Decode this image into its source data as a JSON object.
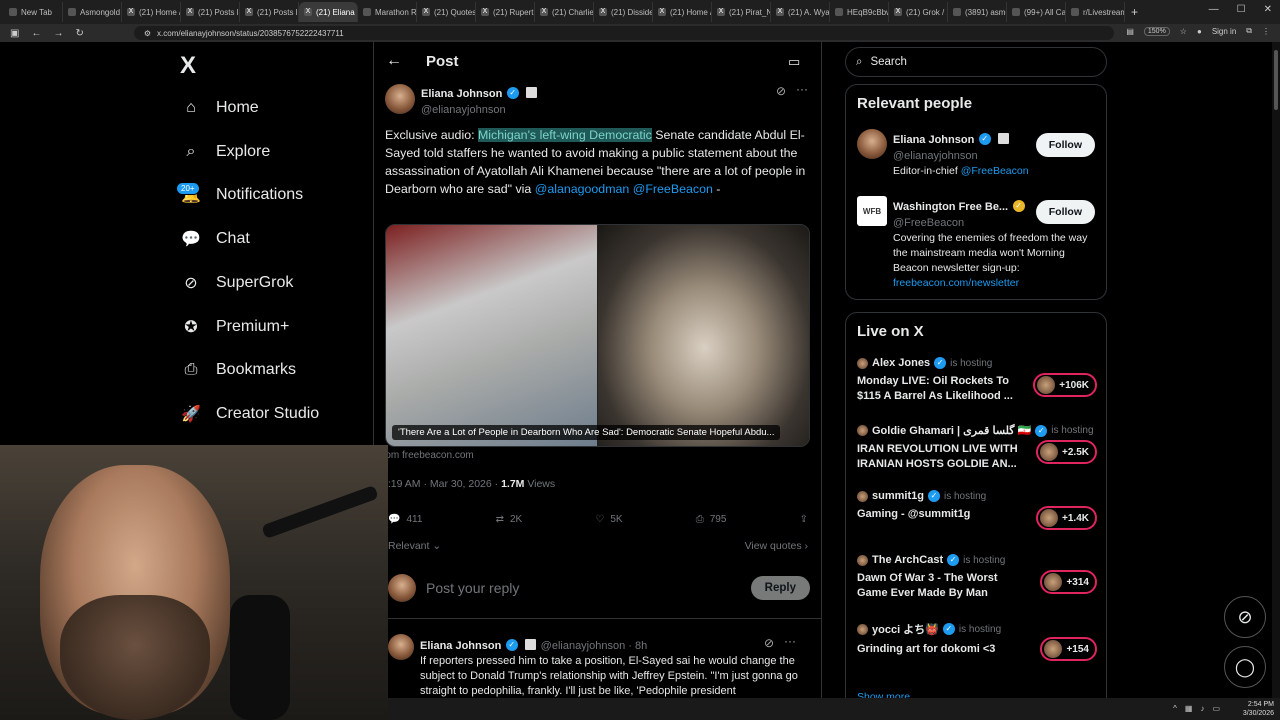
{
  "browser": {
    "tabs": [
      {
        "label": "New Tab",
        "fav": ""
      },
      {
        "label": "Asmongold",
        "fav": ""
      },
      {
        "label": "(21) Home / X",
        "fav": "X"
      },
      {
        "label": "(21) Posts like",
        "fav": "X"
      },
      {
        "label": "(21) Posts like",
        "fav": "X"
      },
      {
        "label": "(21) Eliana",
        "fav": "X"
      },
      {
        "label": "Marathon Rev",
        "fav": ""
      },
      {
        "label": "(21) Quotes of",
        "fav": "X"
      },
      {
        "label": "(21) Rupert Lo",
        "fav": "X"
      },
      {
        "label": "(21) Charlie D",
        "fav": "X"
      },
      {
        "label": "(21) Dissident",
        "fav": "X"
      },
      {
        "label": "(21) Home / X",
        "fav": "X"
      },
      {
        "label": "(21) Pirat_Nat",
        "fav": "X"
      },
      {
        "label": "(21) A. Wyatt",
        "fav": "X"
      },
      {
        "label": "HEqB9cBbwA",
        "fav": ""
      },
      {
        "label": "(21) Grok / X",
        "fav": "X"
      },
      {
        "label": "(3891) asmon",
        "fav": ""
      },
      {
        "label": "(99+) All Cate",
        "fav": ""
      },
      {
        "label": "r/Livestreamf",
        "fav": ""
      }
    ],
    "active_tab_index": 5,
    "url": "x.com/elianayjohnson/status/2038576752222437711",
    "zoom": "150%",
    "signin": "Sign in"
  },
  "sidebar": {
    "logo": "X",
    "items": [
      {
        "label": "Home",
        "icon": "home-icon"
      },
      {
        "label": "Explore",
        "icon": "search-icon"
      },
      {
        "label": "Notifications",
        "icon": "bell-icon"
      },
      {
        "label": "Chat",
        "icon": "chat-icon"
      },
      {
        "label": "SuperGrok",
        "icon": "grok-icon"
      },
      {
        "label": "Premium+",
        "icon": "premium-icon"
      },
      {
        "label": "Bookmarks",
        "icon": "bookmark-icon"
      },
      {
        "label": "Creator Studio",
        "icon": "rocket-icon"
      }
    ],
    "notifications_badge": "20+"
  },
  "post": {
    "header_title": "Post",
    "author_name": "Eliana Johnson",
    "author_handle": "@elianayjohnson",
    "text_highlight": "Michigan's left-wing Democratic",
    "text_prefix": "Exclusive audio: ",
    "text_rest": " Senate candidate Abdul El-Sayed told staffers he wanted to avoid making a public statement about the assassination of Ayatollah Ali Khamenei because \"there are a lot of people in Dearborn who are sad\" via ",
    "mention1": "@alanagoodman",
    "mention2": "@FreeBeacon",
    "text_end": " -",
    "media_caption": "'There Are a Lot of People in Dearborn Who Are Sad': Democratic Senate Hopeful Abdu...",
    "from_source": "rom freebeacon.com",
    "timestamp": "6:19 AM · Mar 30, 2026 · ",
    "views_count": "1.7M",
    "views_label": " Views",
    "replies": "411",
    "reposts": "2K",
    "likes": "5K",
    "bookmarks": "795",
    "sort_label": "Relevant",
    "view_quotes": "View quotes",
    "reply_placeholder": "Post your reply",
    "reply_button": "Reply"
  },
  "reply": {
    "author_name": "Eliana Johnson",
    "author_handle": "@elianayjohnson · 8h",
    "text": "If reporters pressed him to take a position, El-Sayed sai he would change the subject to Donald Trump's relationship with Jeffrey Epstein. \"I'm just gonna go straight to pedophilia, frankly. I'll just be like, 'Pedophile president"
  },
  "right": {
    "search_placeholder": "Search",
    "relevant_title": "Relevant people",
    "people": [
      {
        "name": "Eliana Johnson",
        "handle": "@elianayjohnson",
        "bio_prefix": "Editor-in-chief ",
        "bio_link": "@FreeBeacon",
        "follow": "Follow"
      },
      {
        "name": "Washington Free Be...",
        "handle": "@FreeBeacon",
        "bio": "Covering the enemies of freedom the way the mainstream media won't Morning Beacon newsletter sign-up:",
        "bio_link": "freebeacon.com/newsletter",
        "follow": "Follow",
        "logo": "WFB"
      }
    ],
    "live_title": "Live on X",
    "hosting_label": "is hosting",
    "live": [
      {
        "host": "Alex Jones",
        "title": "Monday LIVE: Oil Rockets To $115 A Barrel As Likelihood ...",
        "count": "+106K"
      },
      {
        "host": "Goldie Ghamari | گلسا قمری 🇮🇷",
        "title": "IRAN REVOLUTION LIVE WITH IRANIAN HOSTS GOLDIE AN...",
        "count": "+2.5K"
      },
      {
        "host": "summit1g",
        "title": "Gaming - @summit1g",
        "count": "+1.4K"
      },
      {
        "host": "The ArchCast",
        "title": "Dawn Of War 3 - The Worst Game Ever Made By Man",
        "count": "+314"
      },
      {
        "host": "yocci よち👹",
        "title": "Grinding art for dokomi <3",
        "count": "+154"
      }
    ],
    "show_more": "Show more"
  },
  "taskbar": {
    "time": "2:54 PM",
    "date": "3/30/2026"
  },
  "colors": {
    "accent": "#1d9bf0",
    "live_ring": "#e0245e",
    "highlight_bg": "#1f5a58"
  }
}
